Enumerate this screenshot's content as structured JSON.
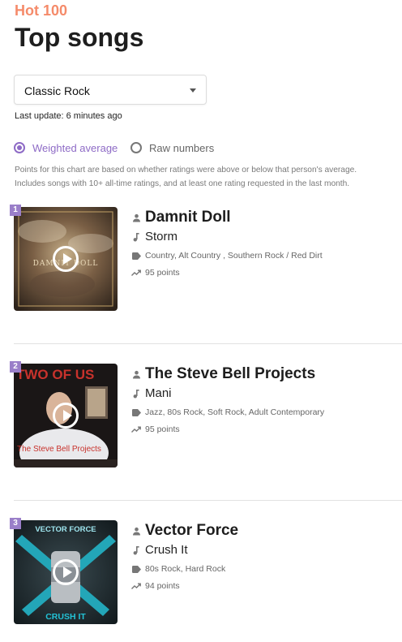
{
  "header": {
    "eyebrow": "Hot 100",
    "title": "Top songs"
  },
  "genre_select": {
    "value": "Classic Rock"
  },
  "last_update": "Last update: 6 minutes ago",
  "mode": {
    "options": [
      {
        "label": "Weighted average",
        "selected": true
      },
      {
        "label": "Raw numbers",
        "selected": false
      }
    ]
  },
  "description": "Points for this chart are based on whether ratings were above or below that person's average. Includes songs with 10+ all-time ratings, and at least one rating requested in the last month.",
  "colors": {
    "accent": "#8e6bc6",
    "eyebrow": "#f58b6a",
    "rank_badge": "#9a7fc9"
  },
  "songs": [
    {
      "rank": "1",
      "artist": "Damnit Doll",
      "track": "Storm",
      "genres": "Country, Alt Country , Southern Rock / Red Dirt",
      "points": "95 points",
      "cover_text": "DAMNIT DOLL"
    },
    {
      "rank": "2",
      "artist": "The Steve Bell Projects",
      "track": "Mani",
      "genres": "Jazz, 80s Rock, Soft Rock, Adult Contemporary",
      "points": "95 points",
      "cover_text_top": "TWO OF US",
      "cover_text_bottom": "The Steve Bell Projects"
    },
    {
      "rank": "3",
      "artist": "Vector Force",
      "track": "Crush It",
      "genres": "80s Rock, Hard Rock",
      "points": "94 points",
      "cover_text_top": "VECTOR FORCE",
      "cover_text_bottom": "CRUSH IT"
    }
  ]
}
